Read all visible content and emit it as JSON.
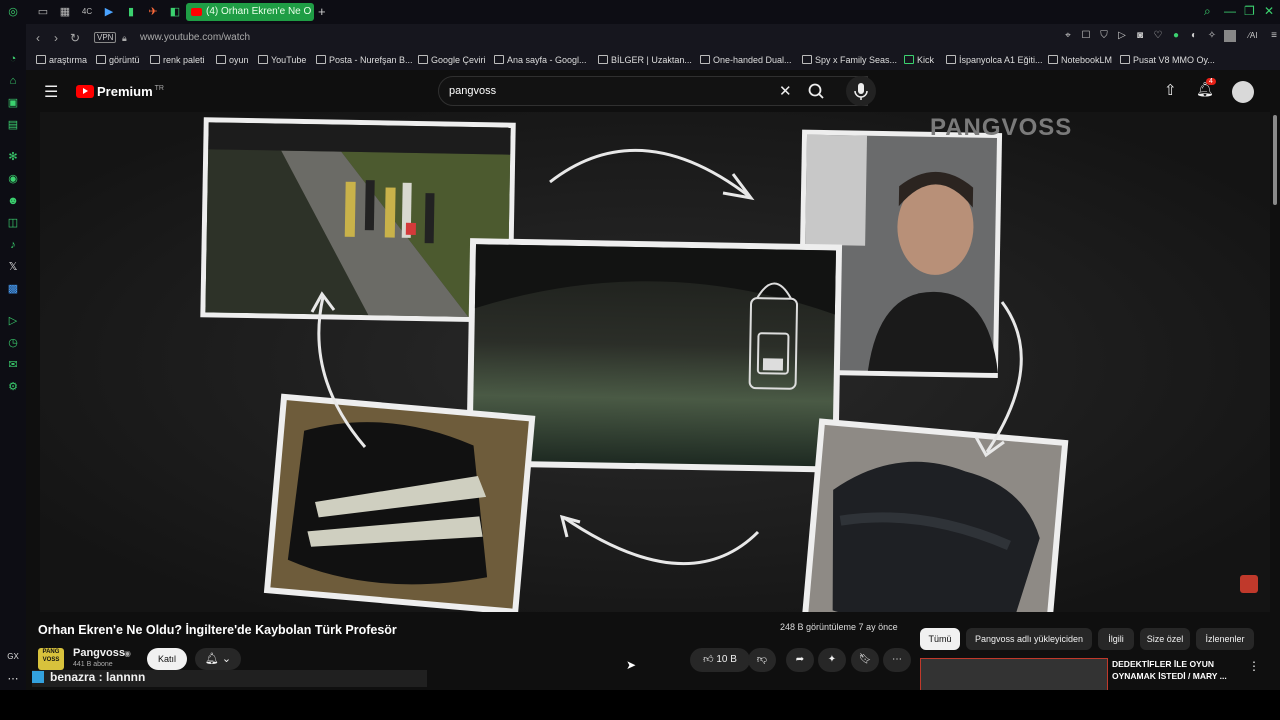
{
  "browser": {
    "active_tab_label": "(4) Orhan Ekren'e Ne O",
    "url": "www.youtube.com/watch",
    "vpn_label": "VPN",
    "tab_icons": [
      "○",
      "▭",
      "▦",
      "4C",
      "▶",
      "▮",
      "✈",
      "◧"
    ]
  },
  "bookmarks": [
    "araştırma",
    "görüntü",
    "renk paleti",
    "oyun",
    "YouTube",
    "Posta - Nurefşan B...",
    "Google Çeviri",
    "Ana sayfa - Googl...",
    "BİLGER | Uzaktan...",
    "One-handed Dual...",
    "Spy x Family Seas...",
    "Kick",
    "İspanyolca A1 Eğiti...",
    "NotebookLM",
    "Pusat V8 MMO Oy..."
  ],
  "youtube": {
    "logo_text": "Premium",
    "region": "TR",
    "search_value": "pangvoss",
    "notification_count": "4"
  },
  "video": {
    "watermark": "PANGVOSS",
    "title": "Orhan Ekren'e Ne Oldu? İngiltere'de Kaybolan Türk Profesör",
    "views": "248 B görüntüleme  7 ay önce",
    "channel_name": "Pangvoss",
    "subscribers": "441 B abone",
    "join_label": "Katıl",
    "likes": "10 B"
  },
  "chat": {
    "user": "benazra",
    "message": "benazra : lannnn"
  },
  "chips": [
    "Tümü",
    "Pangvoss adlı yükleyiciden",
    "İlgili",
    "Size özel",
    "İzlenenler"
  ],
  "recommendation": {
    "title": "DEDEKTİFLER İLE OYUN OYNAMAK İSTEDİ / MARY ..."
  },
  "colors": {
    "gx_accent": "#3bd16f",
    "youtube_red": "#ff0000",
    "background": "#0f0f0f"
  }
}
